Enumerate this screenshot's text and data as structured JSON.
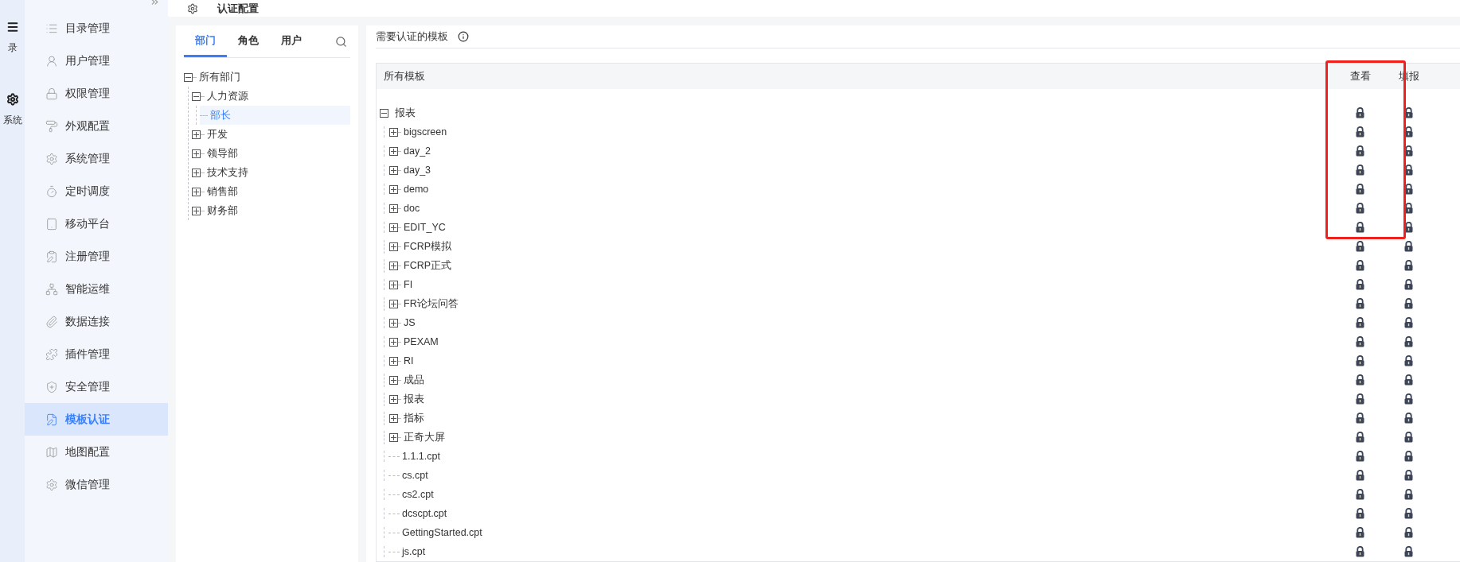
{
  "left_rail": {
    "items": [
      {
        "label": "录"
      },
      {
        "label": "系统"
      }
    ]
  },
  "sidebar": {
    "items": [
      {
        "label": "目录管理",
        "selected": false
      },
      {
        "label": "用户管理",
        "selected": false
      },
      {
        "label": "权限管理",
        "selected": false
      },
      {
        "label": "外观配置",
        "selected": false
      },
      {
        "label": "系统管理",
        "selected": false
      },
      {
        "label": "定时调度",
        "selected": false
      },
      {
        "label": "移动平台",
        "selected": false
      },
      {
        "label": "注册管理",
        "selected": false
      },
      {
        "label": "智能运维",
        "selected": false
      },
      {
        "label": "数据连接",
        "selected": false
      },
      {
        "label": "插件管理",
        "selected": false
      },
      {
        "label": "安全管理",
        "selected": false
      },
      {
        "label": "模板认证",
        "selected": true
      },
      {
        "label": "地图配置",
        "selected": false
      },
      {
        "label": "微信管理",
        "selected": false
      }
    ]
  },
  "header": {
    "title": "认证配置"
  },
  "member_panel": {
    "tabs": [
      {
        "label": "部门",
        "selected": true
      },
      {
        "label": "角色",
        "selected": false
      },
      {
        "label": "用户",
        "selected": false
      }
    ],
    "tree": [
      {
        "label": "所有部门",
        "expanded": true,
        "selected": false,
        "children": [
          {
            "label": "人力资源",
            "expanded": true,
            "selected": false,
            "children": [
              {
                "label": "部长",
                "selected": true
              }
            ]
          },
          {
            "label": "开发",
            "expanded": false,
            "selected": false
          },
          {
            "label": "领导部",
            "expanded": false,
            "selected": false
          },
          {
            "label": "技术支持",
            "expanded": false,
            "selected": false
          },
          {
            "label": "销售部",
            "expanded": false,
            "selected": false
          },
          {
            "label": "财务部",
            "expanded": false,
            "selected": false
          }
        ]
      }
    ]
  },
  "template_panel": {
    "title": "需要认证的模板",
    "columns": [
      "所有模板",
      "查看",
      "填报"
    ],
    "tree": [
      {
        "label": "报表",
        "kind": "folder",
        "expanded": true,
        "children": [
          {
            "label": "bigscreen",
            "kind": "folder",
            "expanded": false
          },
          {
            "label": "day_2",
            "kind": "folder",
            "expanded": false
          },
          {
            "label": "day_3",
            "kind": "folder",
            "expanded": false
          },
          {
            "label": "demo",
            "kind": "folder",
            "expanded": false
          },
          {
            "label": "doc",
            "kind": "folder",
            "expanded": false
          },
          {
            "label": "EDIT_YC",
            "kind": "folder",
            "expanded": false
          },
          {
            "label": "FCRP模拟",
            "kind": "folder",
            "expanded": false
          },
          {
            "label": "FCRP正式",
            "kind": "folder",
            "expanded": false
          },
          {
            "label": "FI",
            "kind": "folder",
            "expanded": false
          },
          {
            "label": "FR论坛问答",
            "kind": "folder",
            "expanded": false
          },
          {
            "label": "JS",
            "kind": "folder",
            "expanded": false
          },
          {
            "label": "PEXAM",
            "kind": "folder",
            "expanded": false
          },
          {
            "label": "RI",
            "kind": "folder",
            "expanded": false
          },
          {
            "label": "成品",
            "kind": "folder",
            "expanded": false
          },
          {
            "label": "报表",
            "kind": "folder",
            "expanded": false
          },
          {
            "label": "指标",
            "kind": "folder",
            "expanded": false
          },
          {
            "label": "正奇大屏",
            "kind": "folder",
            "expanded": false
          },
          {
            "label": "1.1.1.cpt",
            "kind": "file"
          },
          {
            "label": "cs.cpt",
            "kind": "file"
          },
          {
            "label": "cs2.cpt",
            "kind": "file"
          },
          {
            "label": "dcscpt.cpt",
            "kind": "file"
          },
          {
            "label": "GettingStarted.cpt",
            "kind": "file"
          },
          {
            "label": "js.cpt",
            "kind": "file"
          }
        ]
      }
    ]
  }
}
